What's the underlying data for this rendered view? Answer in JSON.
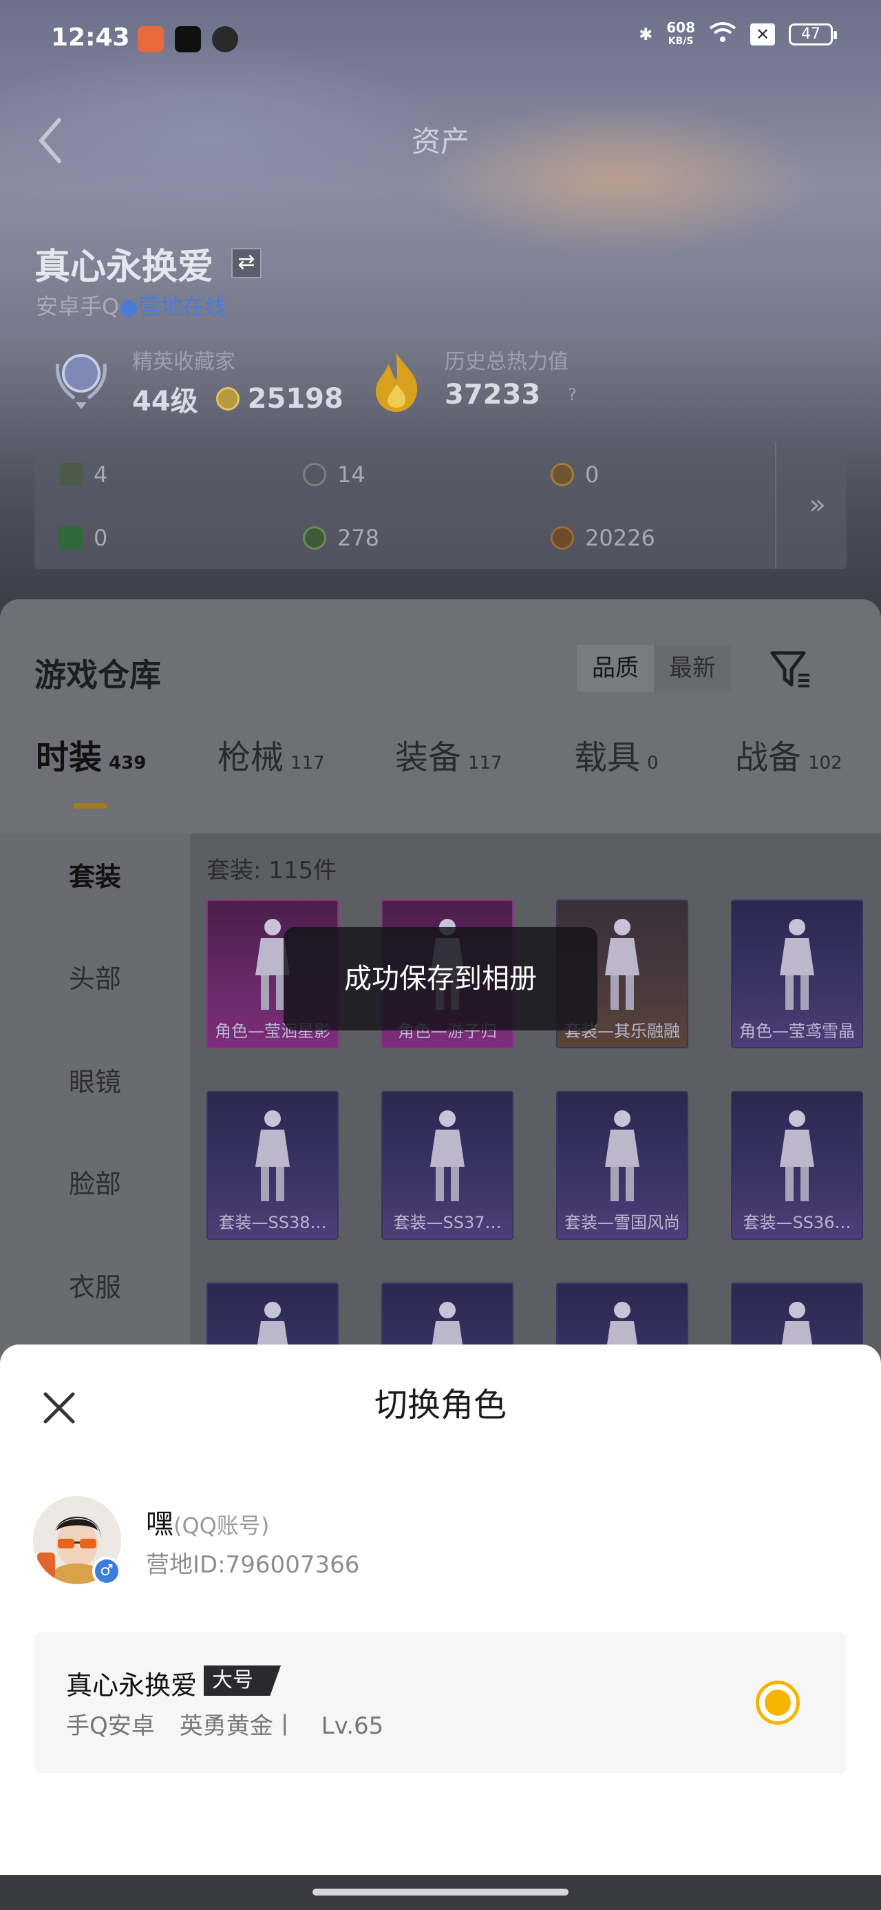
{
  "status_bar": {
    "time": "12:43",
    "net_speed_value": "608",
    "net_speed_unit": "KB/S",
    "battery": "47"
  },
  "header": {
    "title": "资产"
  },
  "player": {
    "name": "真心永换爱",
    "platform": "安卓手Q",
    "online_status": "营地在线",
    "collector_title": "精英收藏家",
    "collector_level": "44级",
    "collector_points": "25198",
    "heat_label": "历史总热力值",
    "heat_value": "37233",
    "heat_help": "?"
  },
  "currencies": [
    {
      "value": "4",
      "color": "#6d7a6a"
    },
    {
      "value": "14",
      "color": "#6a6c74"
    },
    {
      "value": "0",
      "color": "#8a6a3a"
    },
    {
      "value": "0",
      "color": "#3f7a4a"
    },
    {
      "value": "278",
      "color": "#4f6a4a"
    },
    {
      "value": "20226",
      "color": "#8a5a30"
    }
  ],
  "currency_more": "»",
  "warehouse": {
    "title": "游戏仓库",
    "sort": [
      "品质",
      "最新"
    ],
    "tabs": [
      {
        "label": "时装",
        "count": "439"
      },
      {
        "label": "枪械",
        "count": "117"
      },
      {
        "label": "装备",
        "count": "117"
      },
      {
        "label": "载具",
        "count": "0"
      },
      {
        "label": "战备",
        "count": "102"
      }
    ],
    "side_nav": [
      "套装",
      "头部",
      "眼镜",
      "脸部",
      "衣服"
    ],
    "set_count": "套装: 115件",
    "cards": [
      {
        "label": "角色—莹洄星影"
      },
      {
        "label": "角色—游子归"
      },
      {
        "label": "套装—其乐融融"
      },
      {
        "label": "角色—莹鸢雪晶"
      },
      {
        "label": "套装—SS38…"
      },
      {
        "label": "套装—SS37…"
      },
      {
        "label": "套装—雪国风尚"
      },
      {
        "label": "套装—SS36…"
      },
      {
        "label": ""
      },
      {
        "label": ""
      },
      {
        "label": ""
      },
      {
        "label": ""
      }
    ]
  },
  "toast": "成功保存到相册",
  "switch_role": {
    "title": "切换角色",
    "account_name": "嘿",
    "account_type": "(QQ账号)",
    "account_id": "营地ID:796007366",
    "role_name": "真心永换爱",
    "role_tag": "大号",
    "role_platform": "手Q安卓",
    "role_rank": "英勇黄金丨",
    "role_level": "Lv.65"
  }
}
